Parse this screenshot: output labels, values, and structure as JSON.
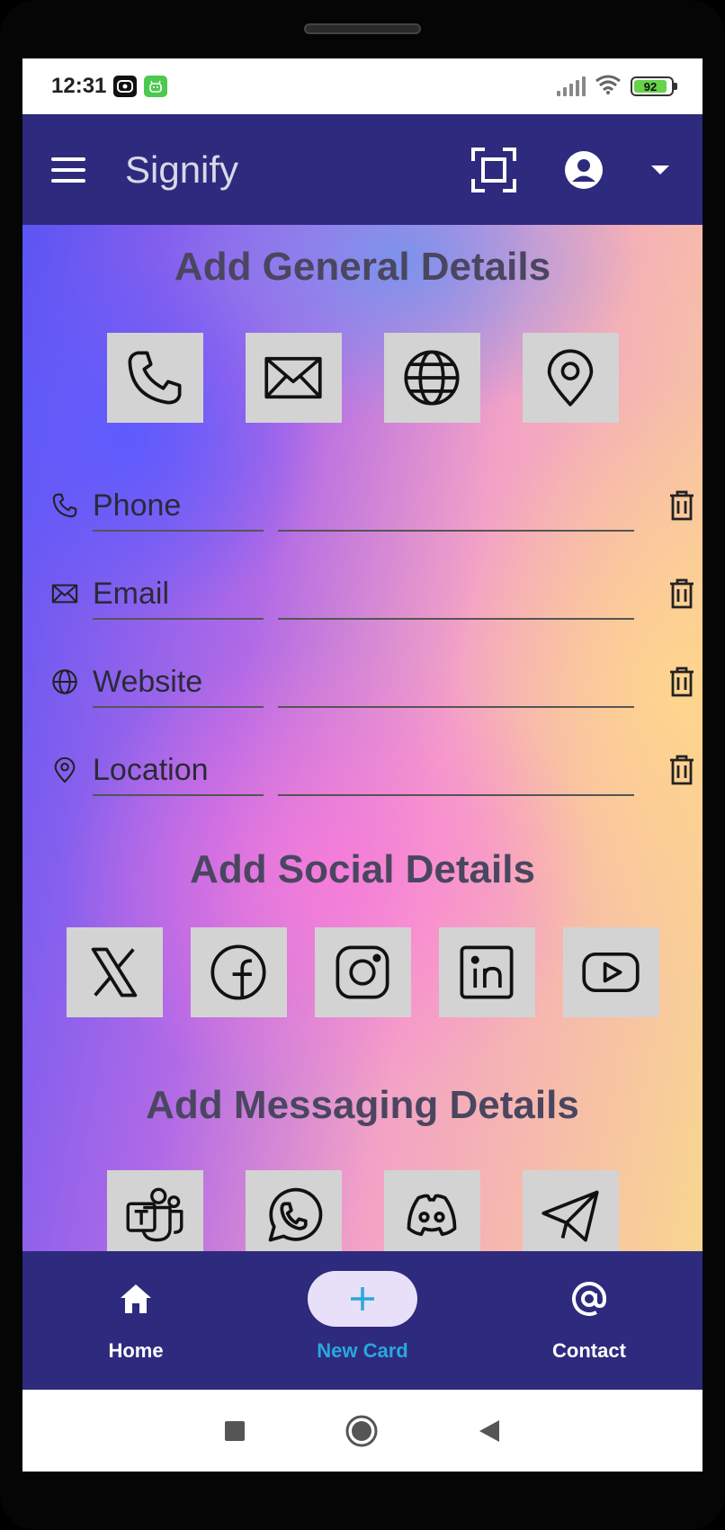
{
  "status_bar": {
    "time": "12:31",
    "battery": "92"
  },
  "app_bar": {
    "title": "Signify"
  },
  "sections": {
    "general_title": "Add General Details",
    "social_title": "Add Social Details",
    "messaging_title": "Add Messaging Details"
  },
  "general_tiles": [
    "phone-icon",
    "email-icon",
    "globe-icon",
    "location-pin-icon"
  ],
  "social_tiles": [
    "x-icon",
    "facebook-icon",
    "instagram-icon",
    "linkedin-icon",
    "youtube-icon"
  ],
  "messaging_tiles": [
    "teams-icon",
    "whatsapp-icon",
    "discord-icon",
    "telegram-icon"
  ],
  "fields": [
    {
      "label": "Phone",
      "value": ""
    },
    {
      "label": "Email",
      "value": ""
    },
    {
      "label": "Website",
      "value": ""
    },
    {
      "label": "Location",
      "value": ""
    }
  ],
  "bottom_nav": {
    "home": "Home",
    "new_card": "New Card",
    "contact": "Contact"
  },
  "colors": {
    "app_bar": "#2e2a7e",
    "tile": "#d3d3d3",
    "active_nav": "#2aa7dc",
    "active_pill": "#e8e0f8"
  }
}
